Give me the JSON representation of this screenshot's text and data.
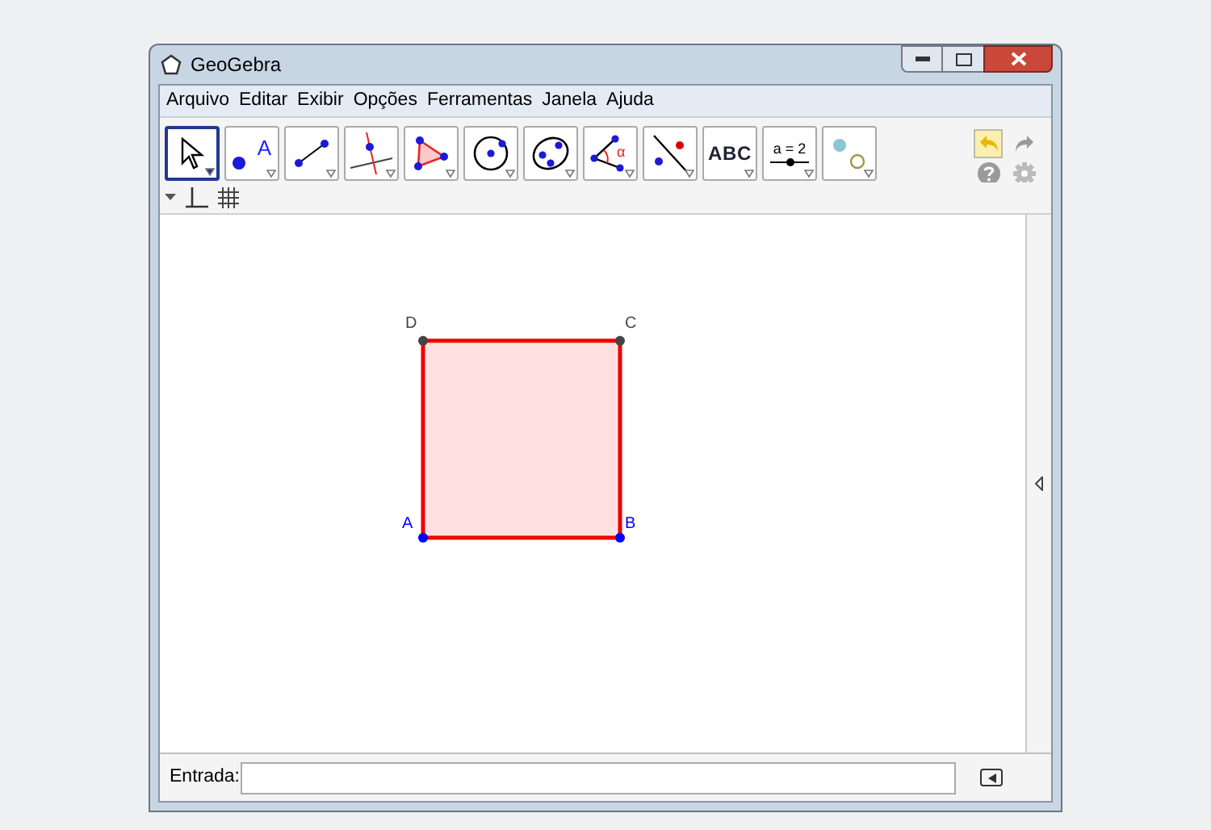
{
  "window": {
    "title": "GeoGebra"
  },
  "menu": [
    "Arquivo",
    "Editar",
    "Exibir",
    "Opções",
    "Ferramentas",
    "Janela",
    "Ajuda"
  ],
  "tools": [
    {
      "kind": "move",
      "selected": true
    },
    {
      "kind": "point",
      "label": "A",
      "selected": false
    },
    {
      "kind": "line",
      "selected": false
    },
    {
      "kind": "perpendicular",
      "selected": false
    },
    {
      "kind": "polygon",
      "selected": false
    },
    {
      "kind": "circle",
      "selected": false
    },
    {
      "kind": "conic",
      "selected": false
    },
    {
      "kind": "angle",
      "label": "α",
      "selected": false
    },
    {
      "kind": "reflect",
      "selected": false
    },
    {
      "kind": "text",
      "label": "ABC",
      "selected": false
    },
    {
      "kind": "slider",
      "label": "a = 2",
      "selected": false
    },
    {
      "kind": "view",
      "selected": false
    }
  ],
  "square": {
    "points": [
      {
        "label": "D",
        "color": "#444444"
      },
      {
        "label": "C",
        "color": "#444444"
      },
      {
        "label": "A",
        "color": "#0000ff"
      },
      {
        "label": "B",
        "color": "#0000ff"
      }
    ]
  },
  "input_bar": {
    "label": "Entrada:"
  }
}
